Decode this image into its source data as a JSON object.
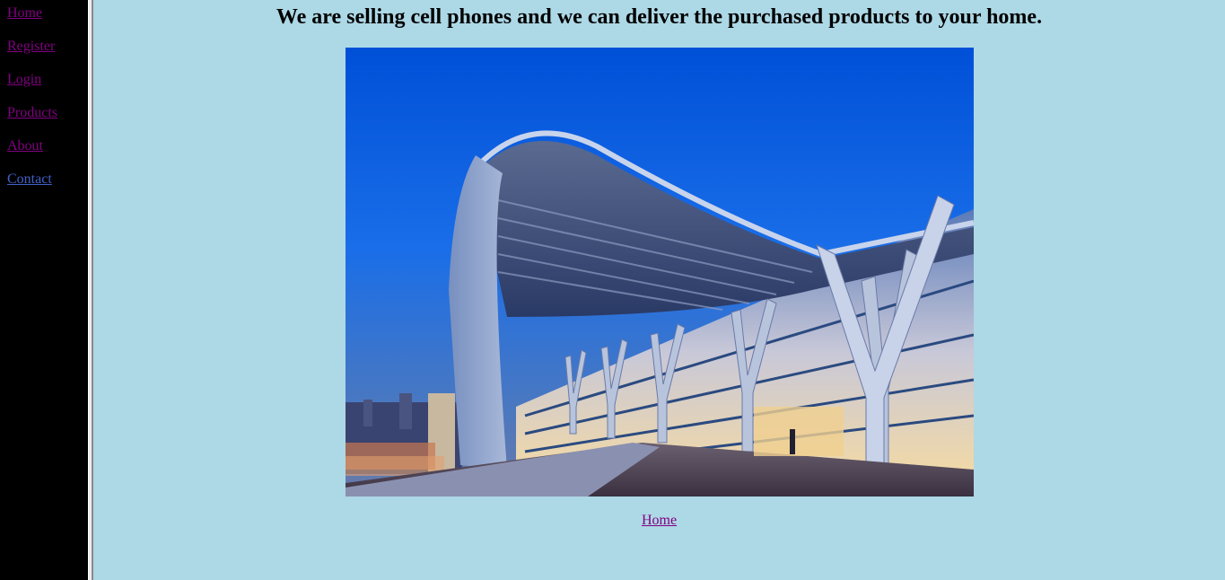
{
  "nav": {
    "items": [
      {
        "label": "Home"
      },
      {
        "label": "Register"
      },
      {
        "label": "Login"
      },
      {
        "label": "Products"
      },
      {
        "label": "About"
      },
      {
        "label": "Contact"
      }
    ]
  },
  "main": {
    "heading": "We are selling cell phones and we can deliver the purchased products to your home.",
    "footer_link": "Home"
  },
  "colors": {
    "page_background": "#ADD8E6",
    "nav_background": "#000000",
    "visited_link": "#800080",
    "unvisited_link": "#4060C8"
  }
}
